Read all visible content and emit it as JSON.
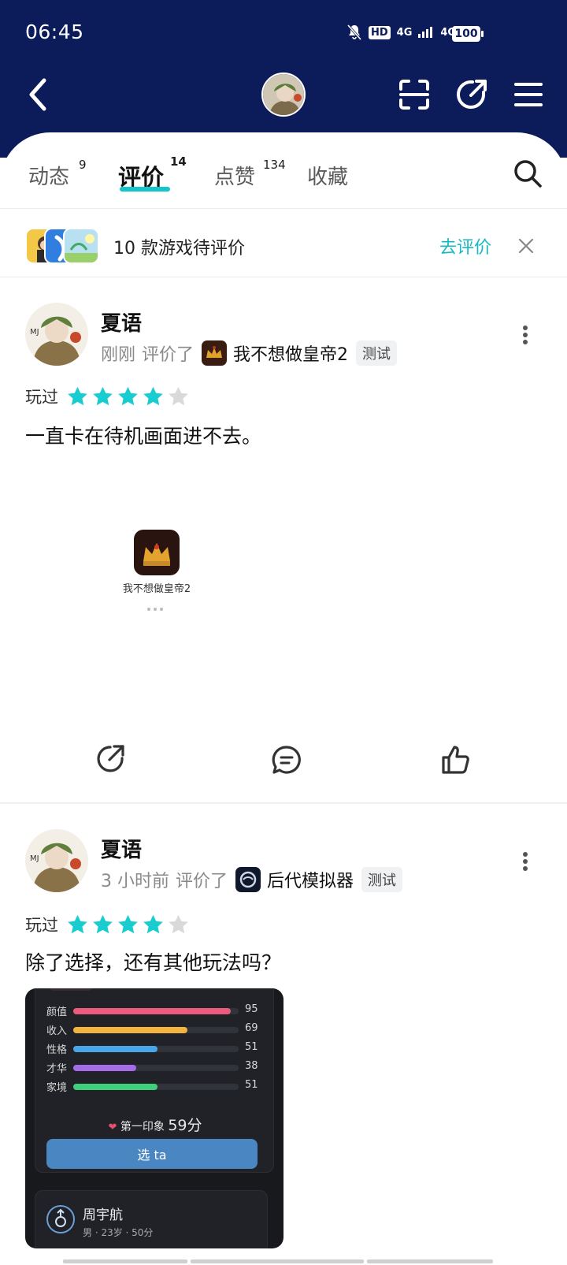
{
  "status_bar": {
    "time": "06:45",
    "network_1": "4G",
    "network_2": "4G",
    "hd": "HD",
    "battery": "100"
  },
  "tabs": [
    {
      "label": "动态",
      "count": "9"
    },
    {
      "label": "评价",
      "count": "14"
    },
    {
      "label": "点赞",
      "count": "134"
    },
    {
      "label": "收藏",
      "count": ""
    }
  ],
  "pending": {
    "text": "10 款游戏待评价",
    "action": "去评价"
  },
  "reviews": [
    {
      "user": "夏语",
      "time": "刚刚",
      "verb": "评价了",
      "game": "我不想做皇帝2",
      "tag": "测试",
      "played": "玩过",
      "rating": 4,
      "text": "一直卡在待机画面进不去。",
      "card_game_name": "我不想做皇帝2"
    },
    {
      "user": "夏语",
      "time": "3 小时前",
      "verb": "评价了",
      "game": "后代模拟器",
      "tag": "测试",
      "played": "玩过",
      "rating": 4,
      "text": "除了选择，还有其他玩法吗？",
      "screenshot": {
        "stats": [
          {
            "label": "颜值",
            "value": 95,
            "color": "#ea5b7e"
          },
          {
            "label": "收入",
            "value": 69,
            "color": "#f2b43f"
          },
          {
            "label": "性格",
            "value": 51,
            "color": "#4aa6ea"
          },
          {
            "label": "才华",
            "value": 38,
            "color": "#a66be6"
          },
          {
            "label": "家境",
            "value": 51,
            "color": "#3fcf7c"
          }
        ],
        "impression_label": "第一印象",
        "impression_score": "59分",
        "button": "选 ta",
        "person_name": "周宇航",
        "person_info": "男 · 23岁 · 50分"
      }
    }
  ],
  "colors": {
    "header": "#0c1b5a",
    "accent": "#15c5ce",
    "star_on": "#17cdd0",
    "star_off": "#d9d9d9"
  }
}
